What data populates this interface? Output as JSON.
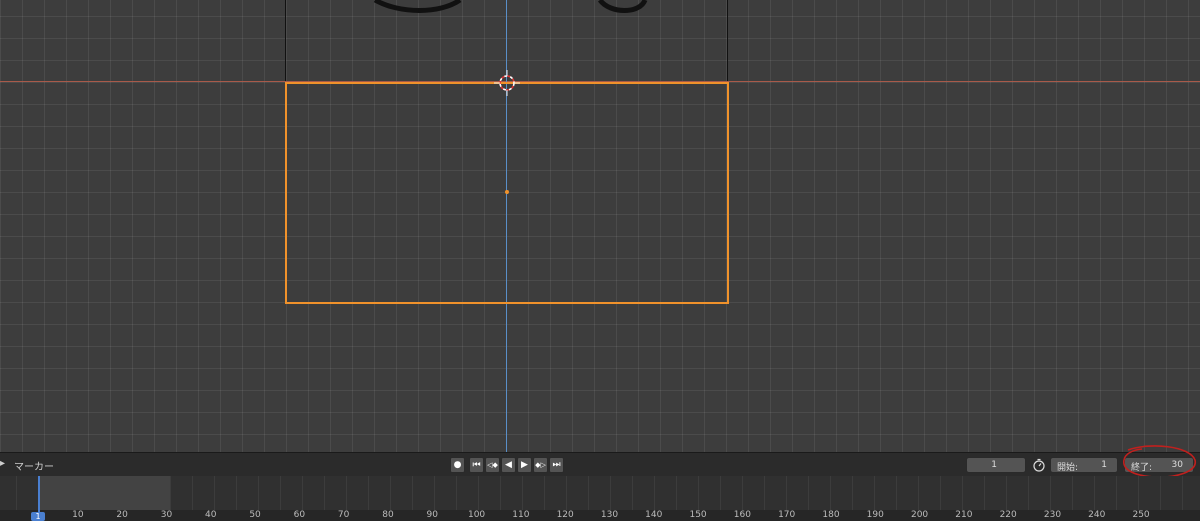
{
  "timeline": {
    "marker_menu": "マーカー",
    "current_frame": "1",
    "start_label": "開始:",
    "start_value": "1",
    "end_label": "終了:",
    "end_value": "30",
    "playhead_frame": "1",
    "ruler_ticks": [
      "10",
      "20",
      "30",
      "40",
      "50",
      "60",
      "70",
      "80",
      "90",
      "100",
      "110",
      "120",
      "130",
      "140",
      "150",
      "160",
      "170",
      "180",
      "190",
      "200",
      "210",
      "220",
      "230",
      "240",
      "250"
    ]
  },
  "icons": {
    "record": "●",
    "jump_start": "⏮",
    "prev_key": "◁◆",
    "play_reverse": "◀",
    "play": "▶",
    "next_key": "◆▷",
    "jump_end": "⏭"
  },
  "colors": {
    "selection": "#f0922b",
    "z_axis": "#5a8fc8",
    "x_axis": "#a85a4a",
    "playhead": "#4a7fd0",
    "annotation": "#c0201e"
  }
}
